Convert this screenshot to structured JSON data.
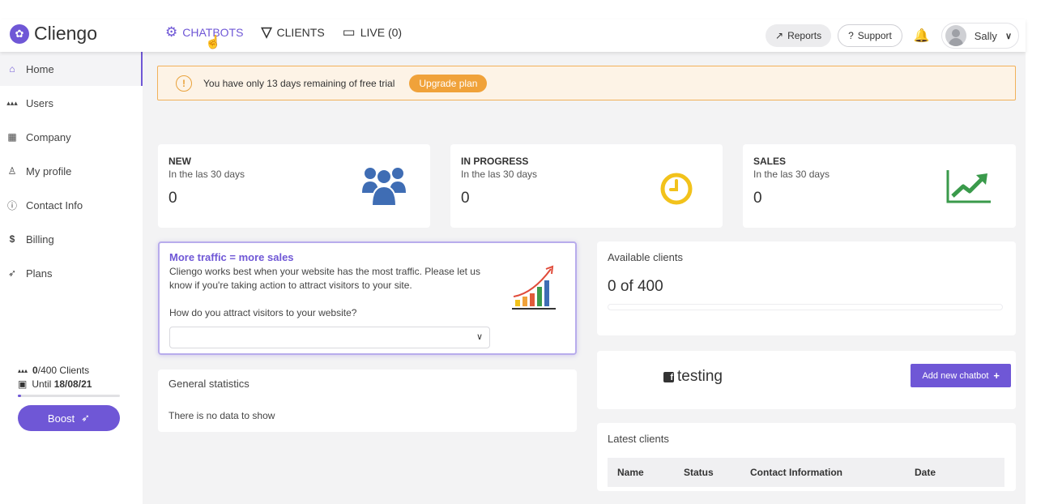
{
  "brand": {
    "name": "Cliengo"
  },
  "nav": {
    "chatbots": "CHATBOTS",
    "clients": "CLIENTS",
    "live": "LIVE (0)"
  },
  "top_right": {
    "reports": "Reports",
    "support": "Support",
    "user_name": "Sally"
  },
  "sidebar": {
    "items": [
      {
        "label": "Home",
        "icon": "home-icon"
      },
      {
        "label": "Users",
        "icon": "users-icon"
      },
      {
        "label": "Company",
        "icon": "building-icon"
      },
      {
        "label": "My profile",
        "icon": "person-icon"
      },
      {
        "label": "Contact Info",
        "icon": "info-icon"
      },
      {
        "label": "Billing",
        "icon": "dollar-icon"
      },
      {
        "label": "Plans",
        "icon": "rocket-icon"
      }
    ],
    "clients_used": "0",
    "clients_total": "/400 Clients",
    "until_label": "Until",
    "until_date": "18/08/21",
    "clients_progress_fraction": 0.0,
    "boost": "Boost"
  },
  "trial": {
    "message": "You have only 13 days remaining of free trial",
    "button": "Upgrade plan"
  },
  "stats": [
    {
      "title": "NEW",
      "subtitle": "In the las 30 days",
      "value": "0",
      "icon": "users-group-icon"
    },
    {
      "title": "IN PROGRESS",
      "subtitle": "In the las 30 days",
      "value": "0",
      "icon": "clock-icon"
    },
    {
      "title": "SALES",
      "subtitle": "In the las 30 days",
      "value": "0",
      "icon": "trend-up-icon"
    }
  ],
  "traffic": {
    "title": "More traffic = more sales",
    "text": "Cliengo works best when your website has the most traffic. Please let us know if you're taking action to attract visitors to your site.",
    "question": "How do you attract visitors to your website?",
    "select_value": ""
  },
  "available": {
    "title": "Available clients",
    "value": "0 of 400"
  },
  "chatbot": {
    "name": "testing",
    "add_button": "Add new chatbot"
  },
  "general": {
    "title": "General statistics",
    "empty": "There is no data to show"
  },
  "latest": {
    "title": "Latest clients",
    "columns": [
      "Name",
      "Status",
      "Contact Information",
      "Date"
    ]
  },
  "colors": {
    "accent": "#6f57d6",
    "warning": "#f0a23a",
    "stat_blue": "#3f6db4",
    "stat_yellow": "#f2c21b",
    "stat_green": "#3a9a4b"
  }
}
